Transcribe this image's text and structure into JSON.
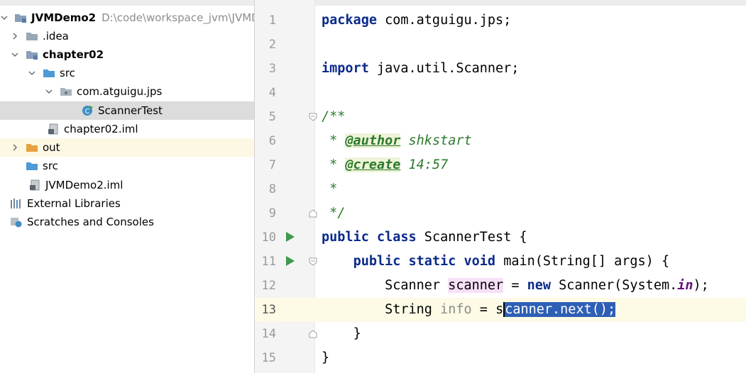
{
  "project_tree": [
    {
      "label": "JVMDemo2",
      "path": "D:\\code\\workspace_jvm\\JVMDe",
      "icon": "module-folder-icon",
      "expanded": true,
      "depth": 0,
      "bold": true
    },
    {
      "label": ".idea",
      "icon": "folder-icon",
      "expanded": false,
      "depth": 1
    },
    {
      "label": "chapter02",
      "icon": "module-folder-icon",
      "expanded": true,
      "depth": 1,
      "bold": true
    },
    {
      "label": "src",
      "icon": "source-folder-icon",
      "expanded": true,
      "depth": 2
    },
    {
      "label": "com.atguigu.jps",
      "icon": "package-icon",
      "expanded": true,
      "depth": 3
    },
    {
      "label": "ScannerTest",
      "icon": "java-class-icon",
      "depth": 4,
      "selected": true
    },
    {
      "label": "chapter02.iml",
      "icon": "iml-file-icon",
      "depth": 2
    },
    {
      "label": "out",
      "icon": "excluded-folder-icon",
      "expanded": false,
      "depth": 1
    },
    {
      "label": "src",
      "icon": "source-folder-icon",
      "depth": 1
    },
    {
      "label": "JVMDemo2.iml",
      "icon": "iml-file-icon",
      "depth": 1
    },
    {
      "label": "External Libraries",
      "icon": "libraries-icon",
      "depth": 0
    },
    {
      "label": "Scratches and Consoles",
      "icon": "scratches-icon",
      "depth": 0
    }
  ],
  "editor": {
    "line_numbers": [
      "1",
      "2",
      "3",
      "4",
      "5",
      "6",
      "7",
      "8",
      "9",
      "10",
      "11",
      "12",
      "13",
      "14",
      "15"
    ],
    "current_line": "13",
    "l1": {
      "kw": "package",
      "rest": " com.atguigu.jps;"
    },
    "l3": {
      "kw": "import",
      "rest": " java.util.Scanner;"
    },
    "l5": {
      "text": "/**"
    },
    "l6": {
      "star": " * ",
      "tag": "@author",
      "val": " shkstart"
    },
    "l7": {
      "star": " * ",
      "tag": "@create",
      "val": " 14:57"
    },
    "l8": {
      "text": " *"
    },
    "l9": {
      "text": " */"
    },
    "l10": {
      "kw1": "public",
      "kw2": "class",
      "name": " ScannerTest {"
    },
    "l11": {
      "kw1": "public",
      "kw2": "static",
      "kw3": "void",
      "rest": " main(String[] args) {"
    },
    "l12": {
      "type": "Scanner",
      "var": "scanner",
      "eq": " = ",
      "kw": "new",
      "call": " Scanner(System.",
      "field": "in",
      "end": ");"
    },
    "l13": {
      "type": "String",
      "var": "info",
      "eq": " = ",
      "pre": "s",
      "sel": "canner.next();"
    },
    "l14": {
      "text": "}"
    },
    "l15": {
      "text": "}"
    }
  }
}
